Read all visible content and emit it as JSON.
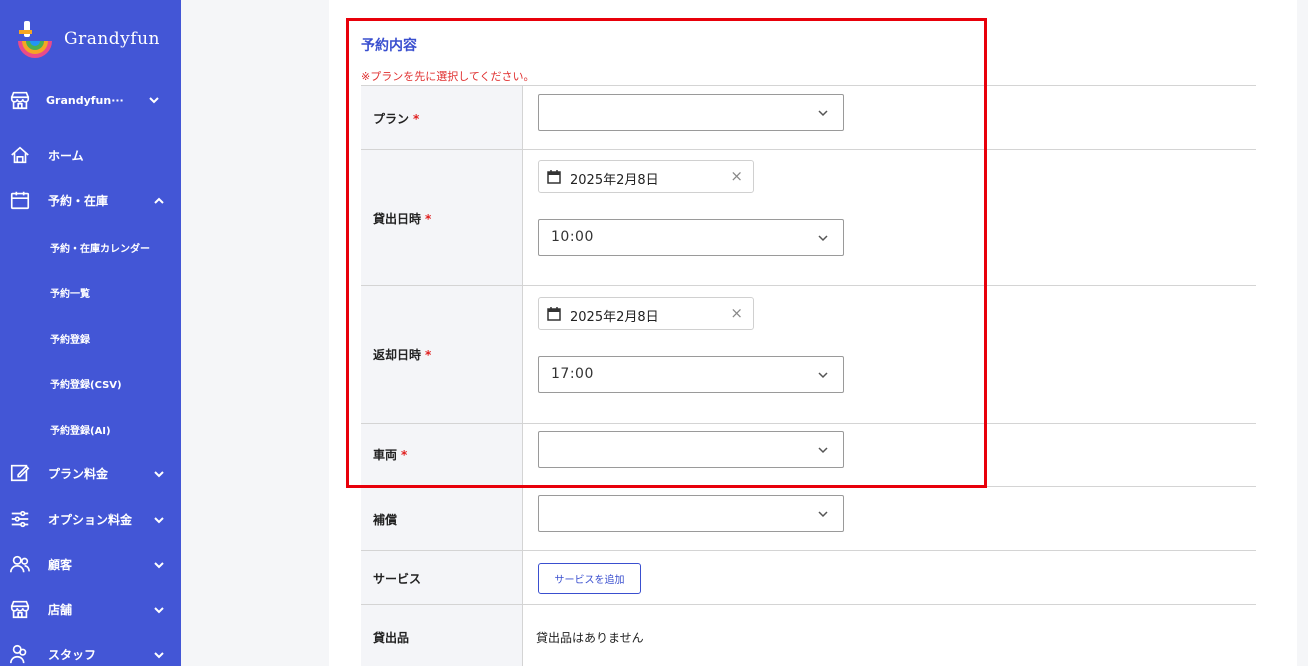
{
  "brand": {
    "name": "Grandyfun"
  },
  "sidebar": {
    "store_selector": "Grandyfun···",
    "items": [
      {
        "label": "ホーム",
        "icon": "home-icon"
      },
      {
        "label": "予約・在庫",
        "icon": "calendar-icon",
        "expanded": true
      },
      {
        "label": "プラン料金",
        "icon": "edit-icon"
      },
      {
        "label": "オプション料金",
        "icon": "sliders-icon"
      },
      {
        "label": "顧客",
        "icon": "users-icon"
      },
      {
        "label": "店舗",
        "icon": "store-icon"
      },
      {
        "label": "スタッフ",
        "icon": "staff-icon"
      }
    ],
    "sub_items": [
      {
        "label": "予約・在庫カレンダー"
      },
      {
        "label": "予約一覧"
      },
      {
        "label": "予約登録"
      },
      {
        "label": "予約登録(CSV)"
      },
      {
        "label": "予約登録(AI)"
      }
    ],
    "bg_color": "#4356d6"
  },
  "form": {
    "section_title": "予約内容",
    "warning": "※プランを先に選択してください。",
    "required_mark": "*",
    "plan": {
      "label": "プラン",
      "value": ""
    },
    "rental": {
      "label": "貸出日時",
      "date": "2025年2月8日",
      "time": "10:00"
    },
    "return": {
      "label": "返却日時",
      "date": "2025年2月8日",
      "time": "17:00"
    },
    "vehicle": {
      "label": "車両",
      "value": ""
    },
    "insurance": {
      "label": "補償",
      "value": ""
    },
    "service": {
      "label": "サービス",
      "button": "サービスを追加"
    },
    "rental_items": {
      "label": "貸出品",
      "value": "貸出品はありません"
    }
  },
  "colors": {
    "accent": "#3a4fcf",
    "warning": "#e03030",
    "highlight": "#e8000a"
  }
}
